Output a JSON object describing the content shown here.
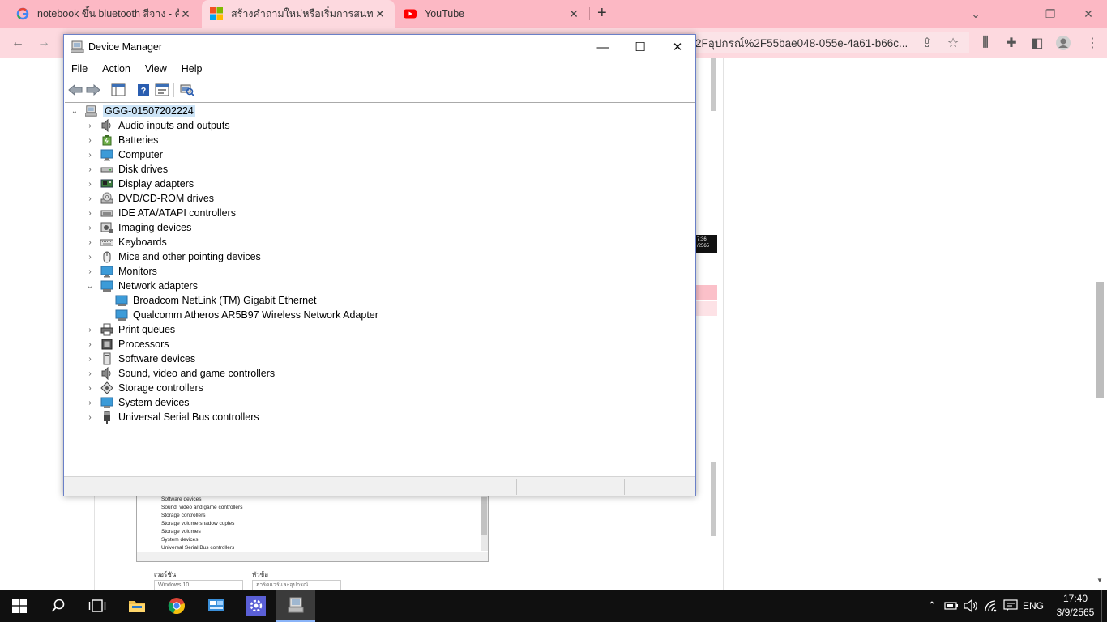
{
  "browser": {
    "tabs": [
      {
        "title": "notebook ขึ้น bluetooth สีจาง - ค้น",
        "favicon": "google-icon"
      },
      {
        "title": "สร้างคำถามใหม่หรือเริ่มการสนทนา",
        "favicon": "microsoft-icon"
      },
      {
        "title": "YouTube",
        "favicon": "youtube-icon"
      }
    ],
    "new_tab": "+",
    "url": "2Fอุปกรณ์%2F55bae048-055e-4a61-b66c..."
  },
  "background_page": {
    "timestamp_lines": [
      "7:36",
      "/2565"
    ],
    "thumbnail_rows": [
      "Software devices",
      "Sound, video and game controllers",
      "Storage controllers",
      "Storage volume shadow copies",
      "Storage volumes",
      "System devices",
      "Universal Serial Bus controllers"
    ],
    "form": {
      "version_label": "เวอร์ชัน",
      "version_value": "Windows 10",
      "topic_label": "หัวข้อ",
      "topic_value": "ฮาร์ดแวร์และอุปกรณ์"
    }
  },
  "device_manager": {
    "title": "Device Manager",
    "menus": [
      "File",
      "Action",
      "View",
      "Help"
    ],
    "root": "GGG-01507202224",
    "categories": [
      {
        "label": "Audio inputs and outputs",
        "icon": "speaker-icon"
      },
      {
        "label": "Batteries",
        "icon": "battery-icon"
      },
      {
        "label": "Computer",
        "icon": "monitor-icon"
      },
      {
        "label": "Disk drives",
        "icon": "disk-drive-icon"
      },
      {
        "label": "Display adapters",
        "icon": "display-adapter-icon"
      },
      {
        "label": "DVD/CD-ROM drives",
        "icon": "dvd-icon"
      },
      {
        "label": "IDE ATA/ATAPI controllers",
        "icon": "ide-controller-icon"
      },
      {
        "label": "Imaging devices",
        "icon": "camera-icon"
      },
      {
        "label": "Keyboards",
        "icon": "keyboard-icon"
      },
      {
        "label": "Mice and other pointing devices",
        "icon": "mouse-icon"
      },
      {
        "label": "Monitors",
        "icon": "monitor-icon"
      },
      {
        "label": "Network adapters",
        "icon": "network-adapter-icon",
        "expanded": true,
        "children": [
          "Broadcom NetLink (TM) Gigabit Ethernet",
          "Qualcomm Atheros AR5B97 Wireless Network Adapter"
        ]
      },
      {
        "label": "Print queues",
        "icon": "printer-icon"
      },
      {
        "label": "Processors",
        "icon": "processor-icon"
      },
      {
        "label": "Software devices",
        "icon": "software-device-icon"
      },
      {
        "label": "Sound, video and game controllers",
        "icon": "speaker-icon"
      },
      {
        "label": "Storage controllers",
        "icon": "storage-controller-icon"
      },
      {
        "label": "System devices",
        "icon": "system-device-icon"
      },
      {
        "label": "Universal Serial Bus controllers",
        "icon": "usb-icon"
      }
    ]
  },
  "taskbar": {
    "language": "ENG",
    "time": "17:40",
    "date": "3/9/2565"
  }
}
